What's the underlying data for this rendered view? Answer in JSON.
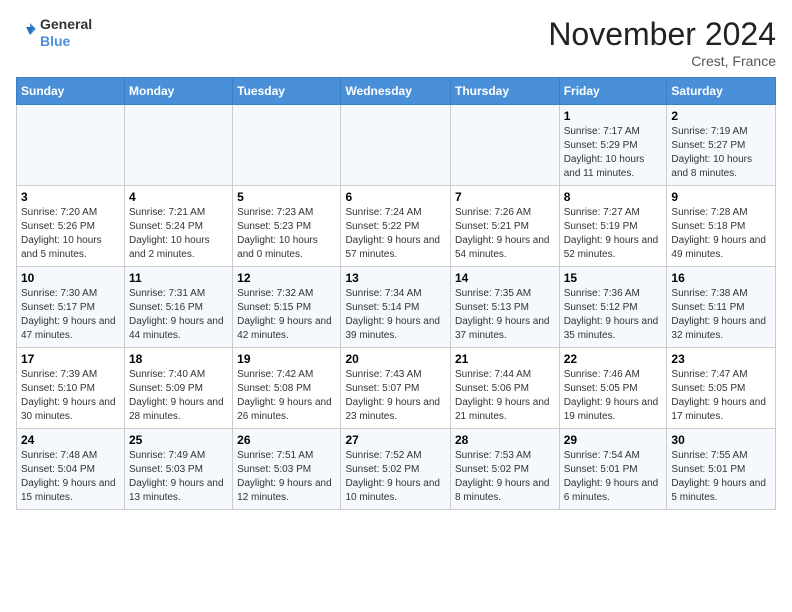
{
  "logo": {
    "line1": "General",
    "line2": "Blue"
  },
  "title": "November 2024",
  "location": "Crest, France",
  "days_of_week": [
    "Sunday",
    "Monday",
    "Tuesday",
    "Wednesday",
    "Thursday",
    "Friday",
    "Saturday"
  ],
  "weeks": [
    [
      {
        "day": "",
        "info": ""
      },
      {
        "day": "",
        "info": ""
      },
      {
        "day": "",
        "info": ""
      },
      {
        "day": "",
        "info": ""
      },
      {
        "day": "",
        "info": ""
      },
      {
        "day": "1",
        "info": "Sunrise: 7:17 AM\nSunset: 5:29 PM\nDaylight: 10 hours and 11 minutes."
      },
      {
        "day": "2",
        "info": "Sunrise: 7:19 AM\nSunset: 5:27 PM\nDaylight: 10 hours and 8 minutes."
      }
    ],
    [
      {
        "day": "3",
        "info": "Sunrise: 7:20 AM\nSunset: 5:26 PM\nDaylight: 10 hours and 5 minutes."
      },
      {
        "day": "4",
        "info": "Sunrise: 7:21 AM\nSunset: 5:24 PM\nDaylight: 10 hours and 2 minutes."
      },
      {
        "day": "5",
        "info": "Sunrise: 7:23 AM\nSunset: 5:23 PM\nDaylight: 10 hours and 0 minutes."
      },
      {
        "day": "6",
        "info": "Sunrise: 7:24 AM\nSunset: 5:22 PM\nDaylight: 9 hours and 57 minutes."
      },
      {
        "day": "7",
        "info": "Sunrise: 7:26 AM\nSunset: 5:21 PM\nDaylight: 9 hours and 54 minutes."
      },
      {
        "day": "8",
        "info": "Sunrise: 7:27 AM\nSunset: 5:19 PM\nDaylight: 9 hours and 52 minutes."
      },
      {
        "day": "9",
        "info": "Sunrise: 7:28 AM\nSunset: 5:18 PM\nDaylight: 9 hours and 49 minutes."
      }
    ],
    [
      {
        "day": "10",
        "info": "Sunrise: 7:30 AM\nSunset: 5:17 PM\nDaylight: 9 hours and 47 minutes."
      },
      {
        "day": "11",
        "info": "Sunrise: 7:31 AM\nSunset: 5:16 PM\nDaylight: 9 hours and 44 minutes."
      },
      {
        "day": "12",
        "info": "Sunrise: 7:32 AM\nSunset: 5:15 PM\nDaylight: 9 hours and 42 minutes."
      },
      {
        "day": "13",
        "info": "Sunrise: 7:34 AM\nSunset: 5:14 PM\nDaylight: 9 hours and 39 minutes."
      },
      {
        "day": "14",
        "info": "Sunrise: 7:35 AM\nSunset: 5:13 PM\nDaylight: 9 hours and 37 minutes."
      },
      {
        "day": "15",
        "info": "Sunrise: 7:36 AM\nSunset: 5:12 PM\nDaylight: 9 hours and 35 minutes."
      },
      {
        "day": "16",
        "info": "Sunrise: 7:38 AM\nSunset: 5:11 PM\nDaylight: 9 hours and 32 minutes."
      }
    ],
    [
      {
        "day": "17",
        "info": "Sunrise: 7:39 AM\nSunset: 5:10 PM\nDaylight: 9 hours and 30 minutes."
      },
      {
        "day": "18",
        "info": "Sunrise: 7:40 AM\nSunset: 5:09 PM\nDaylight: 9 hours and 28 minutes."
      },
      {
        "day": "19",
        "info": "Sunrise: 7:42 AM\nSunset: 5:08 PM\nDaylight: 9 hours and 26 minutes."
      },
      {
        "day": "20",
        "info": "Sunrise: 7:43 AM\nSunset: 5:07 PM\nDaylight: 9 hours and 23 minutes."
      },
      {
        "day": "21",
        "info": "Sunrise: 7:44 AM\nSunset: 5:06 PM\nDaylight: 9 hours and 21 minutes."
      },
      {
        "day": "22",
        "info": "Sunrise: 7:46 AM\nSunset: 5:05 PM\nDaylight: 9 hours and 19 minutes."
      },
      {
        "day": "23",
        "info": "Sunrise: 7:47 AM\nSunset: 5:05 PM\nDaylight: 9 hours and 17 minutes."
      }
    ],
    [
      {
        "day": "24",
        "info": "Sunrise: 7:48 AM\nSunset: 5:04 PM\nDaylight: 9 hours and 15 minutes."
      },
      {
        "day": "25",
        "info": "Sunrise: 7:49 AM\nSunset: 5:03 PM\nDaylight: 9 hours and 13 minutes."
      },
      {
        "day": "26",
        "info": "Sunrise: 7:51 AM\nSunset: 5:03 PM\nDaylight: 9 hours and 12 minutes."
      },
      {
        "day": "27",
        "info": "Sunrise: 7:52 AM\nSunset: 5:02 PM\nDaylight: 9 hours and 10 minutes."
      },
      {
        "day": "28",
        "info": "Sunrise: 7:53 AM\nSunset: 5:02 PM\nDaylight: 9 hours and 8 minutes."
      },
      {
        "day": "29",
        "info": "Sunrise: 7:54 AM\nSunset: 5:01 PM\nDaylight: 9 hours and 6 minutes."
      },
      {
        "day": "30",
        "info": "Sunrise: 7:55 AM\nSunset: 5:01 PM\nDaylight: 9 hours and 5 minutes."
      }
    ]
  ]
}
